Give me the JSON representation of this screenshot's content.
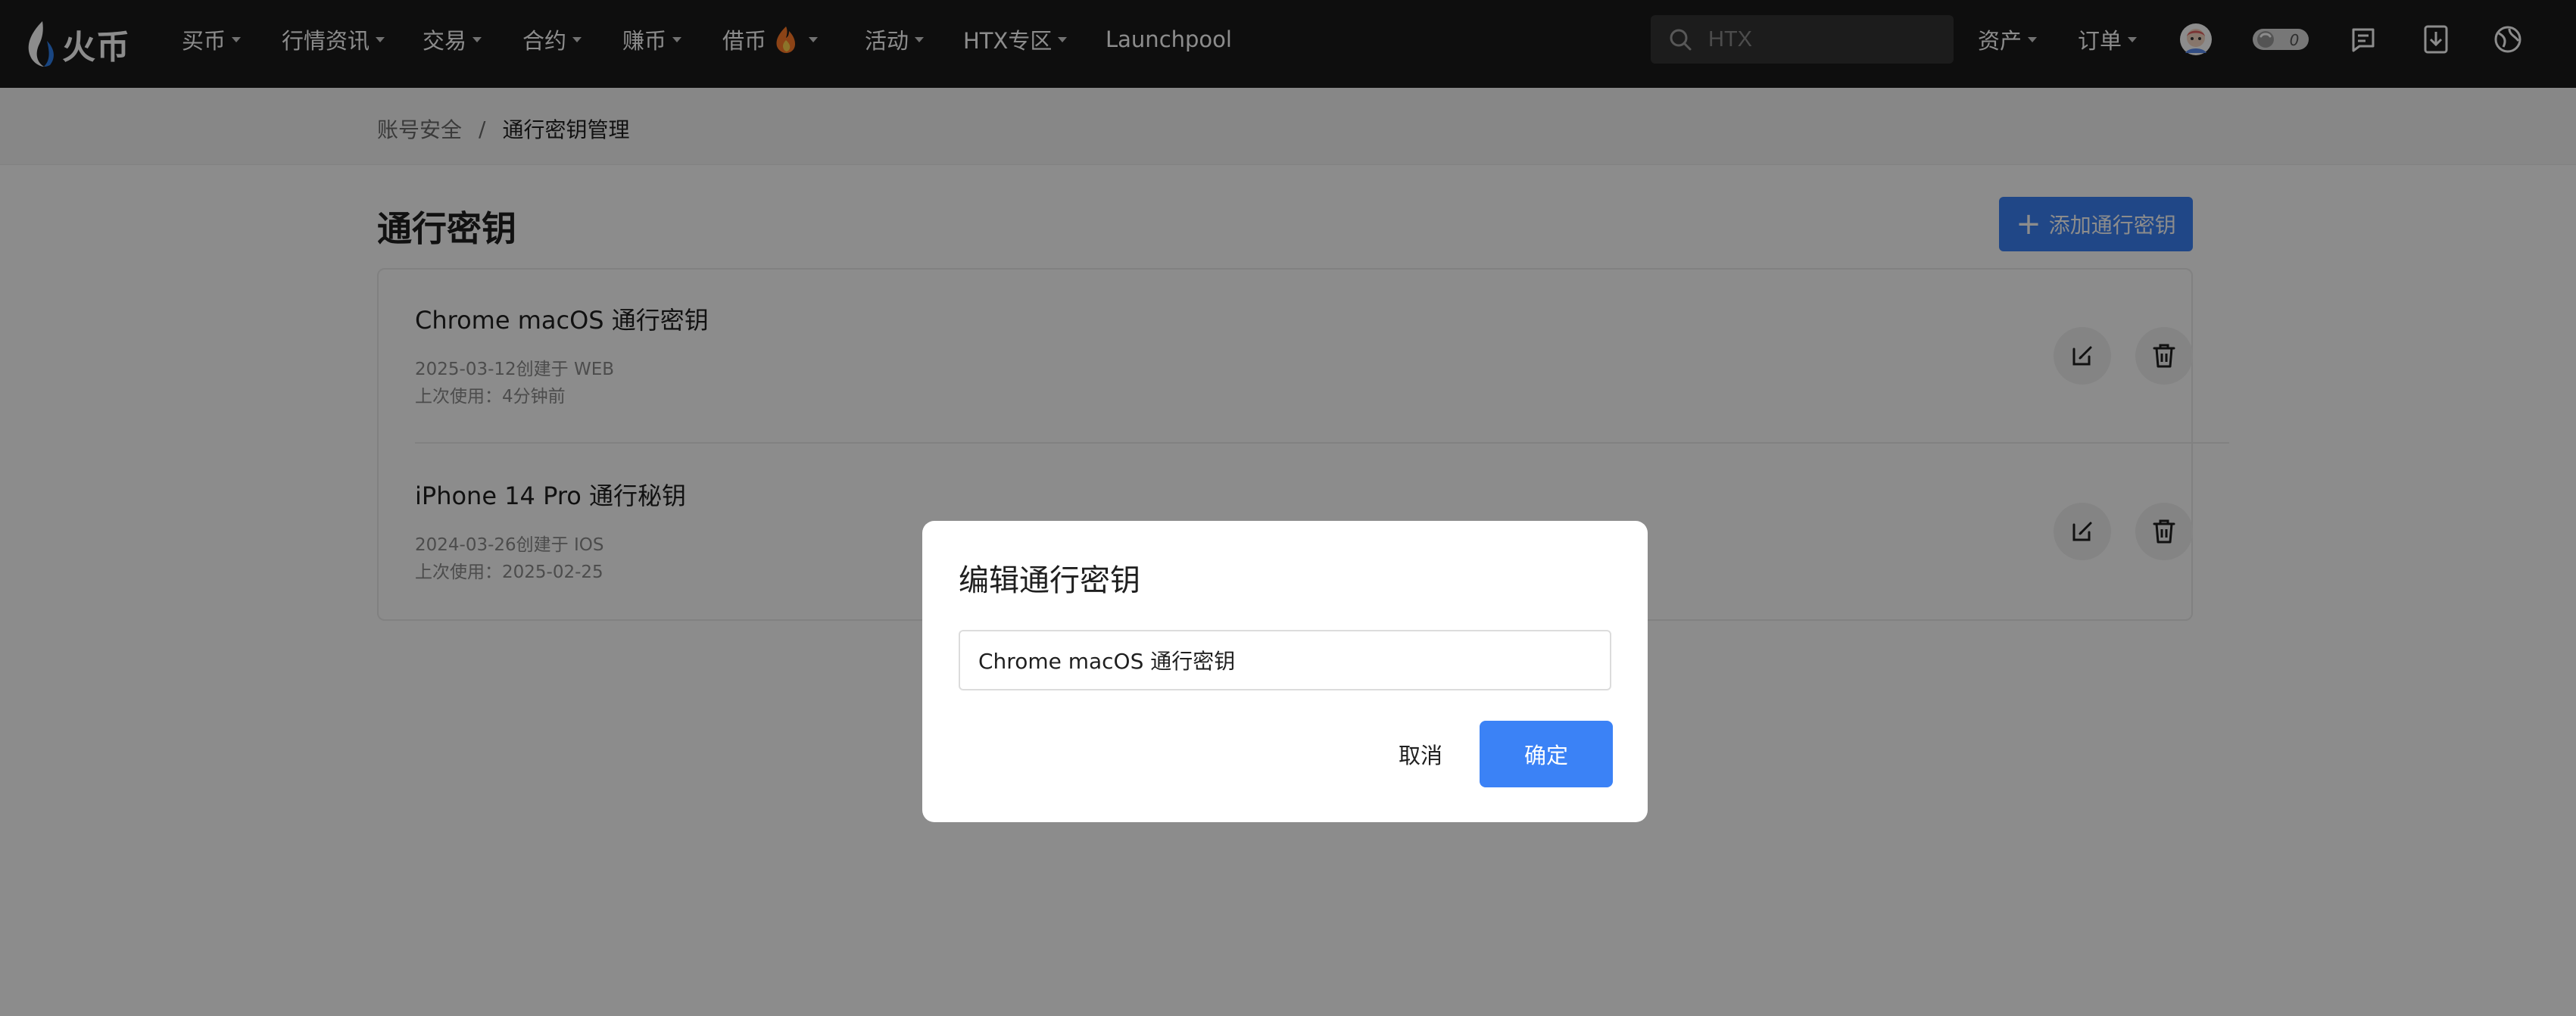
{
  "brand": {
    "name": "火币",
    "accent_color": "#3b82f6"
  },
  "nav": {
    "items": [
      {
        "label": "买币",
        "dropdown": true
      },
      {
        "label": "行情资讯",
        "dropdown": true
      },
      {
        "label": "交易",
        "dropdown": true
      },
      {
        "label": "合约",
        "dropdown": true
      },
      {
        "label": "赚币",
        "dropdown": true
      },
      {
        "label": "借币",
        "dropdown": true,
        "icon": "flame-emoji"
      },
      {
        "label": "活动",
        "dropdown": true
      },
      {
        "label": "HTX专区",
        "dropdown": true
      },
      {
        "label": "Launchpool",
        "dropdown": false
      }
    ],
    "search_placeholder": "HTX",
    "assets_label": "资产",
    "orders_label": "订单",
    "notification_count": "0",
    "right_icons": [
      "avatar-icon",
      "badge-toggle-icon",
      "announcement-icon",
      "download-icon",
      "language-globe-icon"
    ]
  },
  "breadcrumb": {
    "parent": "账号安全",
    "separator": "/",
    "current": "通行密钥管理"
  },
  "page": {
    "title": "通行密钥",
    "add_button_label": "添加通行密钥",
    "passkeys": [
      {
        "name": "Chrome macOS 通行密钥",
        "created": "2025-03-12创建于 WEB",
        "last_used": "上次使用：4分钟前"
      },
      {
        "name": "iPhone 14 Pro 通行秘钥",
        "created": "2024-03-26创建于 IOS",
        "last_used": "上次使用：2025-02-25"
      }
    ]
  },
  "modal": {
    "title": "编辑通行密钥",
    "input_value": "Chrome macOS 通行密钥",
    "cancel_label": "取消",
    "confirm_label": "确定"
  }
}
